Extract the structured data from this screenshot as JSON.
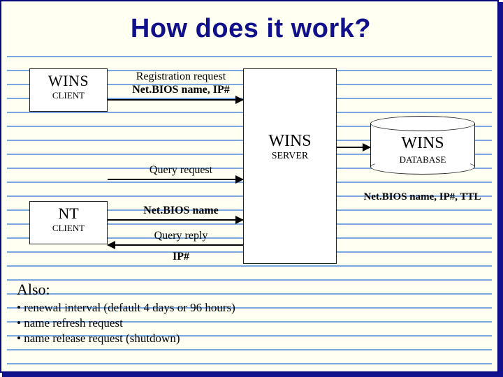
{
  "title": "How does it work?",
  "wins_client": {
    "big": "WINS",
    "small": "CLIENT"
  },
  "nt_client": {
    "big": "NT",
    "small": "CLIENT"
  },
  "server": {
    "big": "WINS",
    "small": "SERVER"
  },
  "database": {
    "big": "WINS",
    "small": "DATABASE"
  },
  "arrows": {
    "registration_l1": "Registration request",
    "registration_l2": "Net.BIOS name, IP#",
    "query_request": "Query request",
    "netbios_name": "Net.BIOS name",
    "query_reply": "Query reply",
    "ip_hash": "IP#"
  },
  "db_caption": "Net.BIOS name, IP#, TTL",
  "also": {
    "heading": "Also:",
    "items": [
      "renewal interval (default 4 days or 96 hours)",
      "name refresh request",
      "name release request (shutdown)"
    ]
  }
}
